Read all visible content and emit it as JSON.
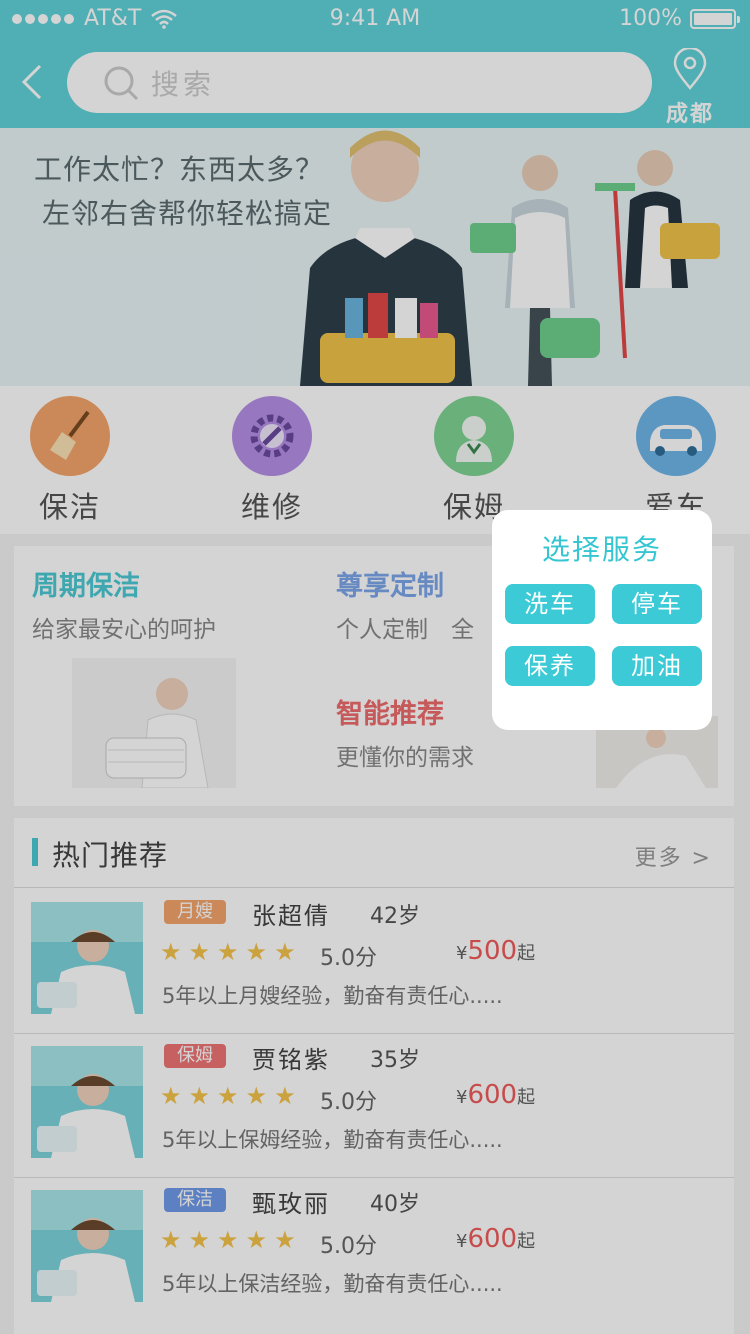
{
  "status_bar": {
    "carrier": "AT&T",
    "time": "9:41 AM",
    "battery": "100%"
  },
  "header": {
    "search_placeholder": "搜索",
    "location": "成都"
  },
  "banner": {
    "line1": "工作太忙？东西太多？",
    "line2": "左邻右舍帮你轻松搞定"
  },
  "categories": [
    {
      "label": "保洁",
      "icon": "broom-icon",
      "color": "#f4a46a"
    },
    {
      "label": "维修",
      "icon": "wrench-gear-icon",
      "color": "#b690e6"
    },
    {
      "label": "保姆",
      "icon": "nanny-icon",
      "color": "#7fd493"
    },
    {
      "label": "爱车",
      "icon": "car-icon",
      "color": "#6fb6e8"
    }
  ],
  "features": {
    "periodic": {
      "title": "周期保洁",
      "subtitle": "给家最安心的呵护"
    },
    "custom": {
      "title": "尊享定制",
      "subtitle": "个人定制　全"
    },
    "smart": {
      "title": "智能推荐",
      "subtitle": "更懂你的需求"
    }
  },
  "hot": {
    "title": "热门推荐",
    "more": "更多 >",
    "items": [
      {
        "tag": "月嫂",
        "tag_color": "#f4a46a",
        "name": "张超倩",
        "age": "42岁",
        "stars": 5,
        "score": "5.0分",
        "currency": "¥",
        "price": "500",
        "price_suffix": "起",
        "desc": "5年以上月嫂经验，勤奋有责任心....."
      },
      {
        "tag": "保姆",
        "tag_color": "#f07474",
        "name": "贾铭紫",
        "age": "35岁",
        "stars": 5,
        "score": "5.0分",
        "currency": "¥",
        "price": "600",
        "price_suffix": "起",
        "desc": "5年以上保姆经验，勤奋有责任心....."
      },
      {
        "tag": "保洁",
        "tag_color": "#6f9bea",
        "name": "甄玫丽",
        "age": "40岁",
        "stars": 5,
        "score": "5.0分",
        "currency": "¥",
        "price": "600",
        "price_suffix": "起",
        "desc": "5年以上保洁经验，勤奋有责任心....."
      }
    ]
  },
  "popup": {
    "title": "选择服务",
    "options": [
      "洗车",
      "停车",
      "保养",
      "加油"
    ]
  }
}
